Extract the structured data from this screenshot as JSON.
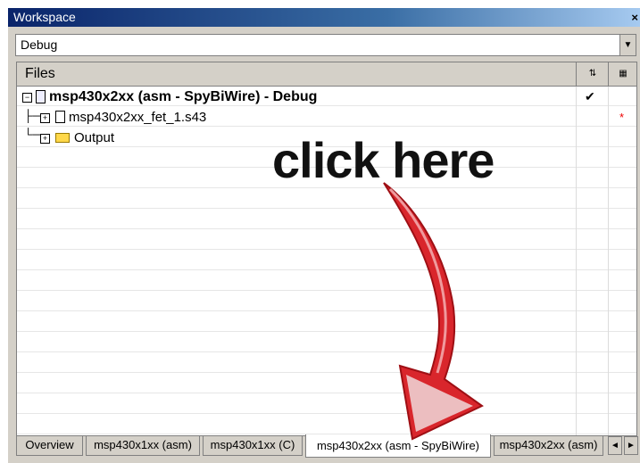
{
  "window": {
    "title": "Workspace",
    "close_label": "×"
  },
  "config_select": {
    "value": "Debug"
  },
  "files_header": {
    "label": "Files"
  },
  "tree": [
    {
      "label": "msp430x2xx (asm - SpyBiWire) - Debug",
      "status": "✔"
    },
    {
      "label": "msp430x2xx_fet_1.s43",
      "status": "*"
    },
    {
      "label": "Output"
    }
  ],
  "annotation": {
    "text": "click here"
  },
  "tabs": [
    {
      "label": "Overview"
    },
    {
      "label": "msp430x1xx (asm)"
    },
    {
      "label": "msp430x1xx (C)"
    },
    {
      "label": "msp430x2xx (asm - SpyBiWire)",
      "active": true
    },
    {
      "label": "msp430x2xx (asm)"
    }
  ],
  "nav": {
    "prev": "◄",
    "next": "►"
  },
  "colors": {
    "arrow": "#d9262c",
    "title_bar": "#0a246a"
  },
  "icons": [
    "dropdown-arrow-icon",
    "make-column-icon",
    "options-column-icon",
    "expand-icon",
    "project-icon",
    "file-icon",
    "folder-icon",
    "checkmark-icon"
  ]
}
